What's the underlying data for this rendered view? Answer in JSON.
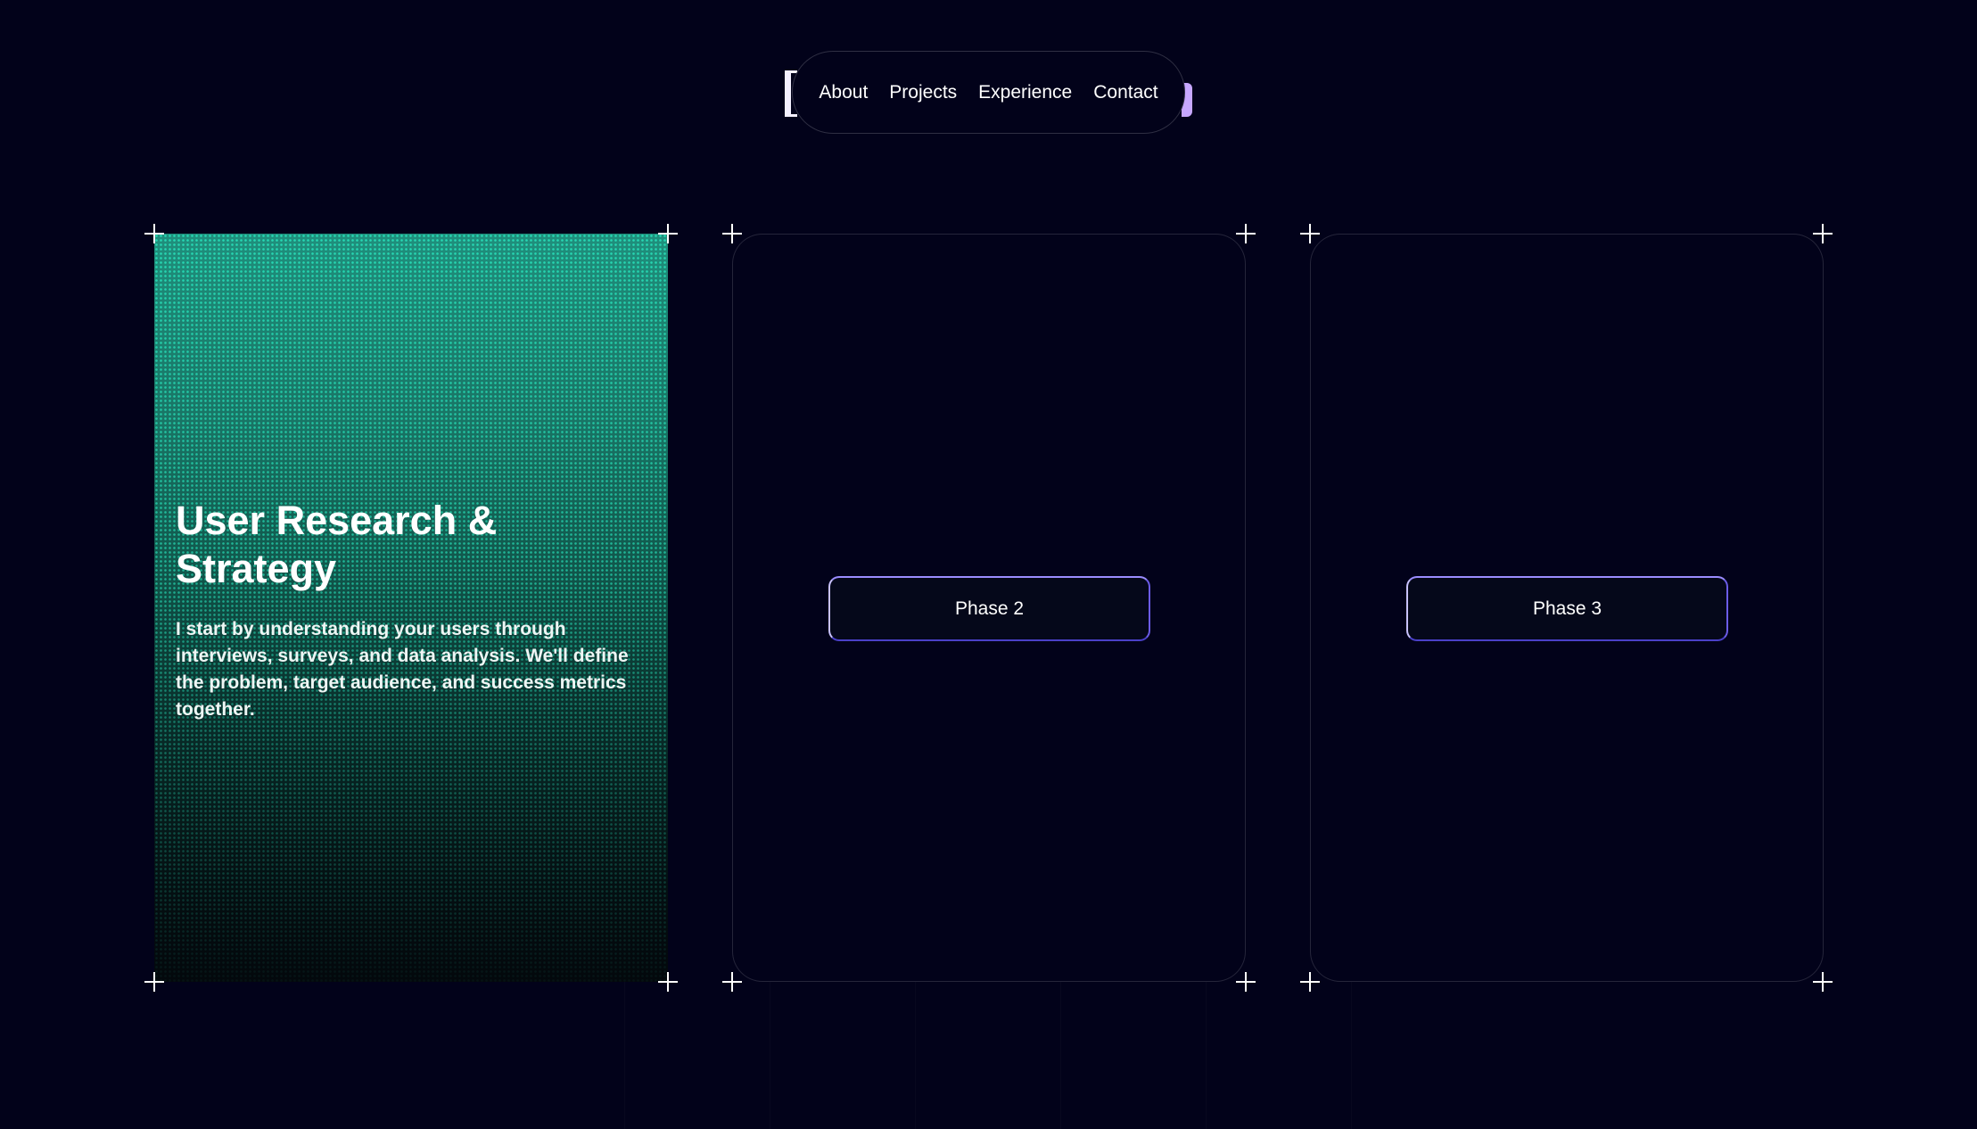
{
  "nav": {
    "items": [
      {
        "label": "About"
      },
      {
        "label": "Projects"
      },
      {
        "label": "Experience"
      },
      {
        "label": "Contact"
      }
    ]
  },
  "cards": [
    {
      "title": "User Research & Strategy",
      "description": "I start by understanding your users through interviews, surveys, and data analysis. We'll define the problem, target audience, and success metrics together."
    },
    {
      "button_label": "Phase 2"
    },
    {
      "button_label": "Phase 3"
    }
  ],
  "colors": {
    "background": "#02021a",
    "accent": "#c7a7ff",
    "card_teal": "#1f8f7c",
    "button_border": "#6b5ce6"
  },
  "icons": [
    "plus-marker-icon"
  ]
}
